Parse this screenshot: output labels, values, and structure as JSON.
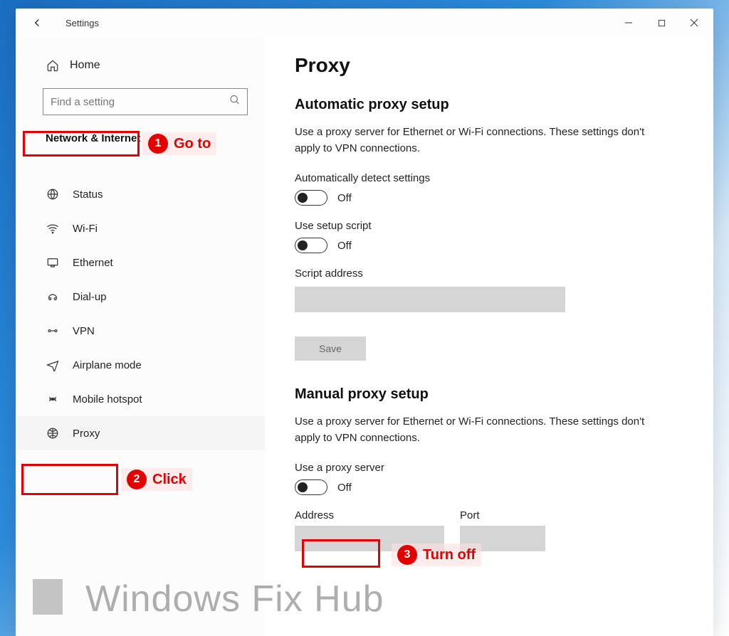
{
  "window": {
    "title": "Settings"
  },
  "sidebar": {
    "home": "Home",
    "search_placeholder": "Find a setting",
    "section": "Network & Internet",
    "items": [
      {
        "label": "Status"
      },
      {
        "label": "Wi-Fi"
      },
      {
        "label": "Ethernet"
      },
      {
        "label": "Dial-up"
      },
      {
        "label": "VPN"
      },
      {
        "label": "Airplane mode"
      },
      {
        "label": "Mobile hotspot"
      },
      {
        "label": "Proxy"
      }
    ]
  },
  "main": {
    "title": "Proxy",
    "auto": {
      "heading": "Automatic proxy setup",
      "desc": "Use a proxy server for Ethernet or Wi-Fi connections. These settings don't apply to VPN connections.",
      "detect_label": "Automatically detect settings",
      "detect_state": "Off",
      "script_label": "Use setup script",
      "script_state": "Off",
      "addr_label": "Script address",
      "save_label": "Save"
    },
    "manual": {
      "heading": "Manual proxy setup",
      "desc": "Use a proxy server for Ethernet or Wi-Fi connections. These settings don't apply to VPN connections.",
      "use_label": "Use a proxy server",
      "use_state": "Off",
      "addr_label": "Address",
      "port_label": "Port"
    }
  },
  "annotations": {
    "a1": {
      "num": "1",
      "text": "Go to"
    },
    "a2": {
      "num": "2",
      "text": "Click"
    },
    "a3": {
      "num": "3",
      "text": "Turn off"
    }
  },
  "watermark": "Windows Fix Hub"
}
